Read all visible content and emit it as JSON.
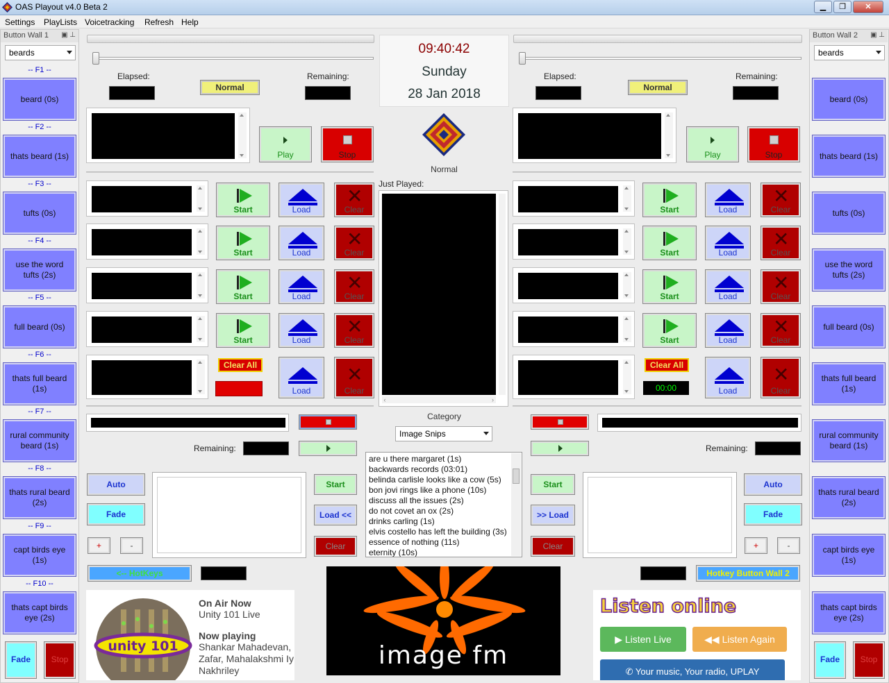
{
  "window": {
    "title": "OAS Playout v4.0 Beta 2"
  },
  "menu": [
    "Settings",
    "PlayLists",
    "Voicetracking",
    "Refresh",
    "Help"
  ],
  "left_wall": {
    "title": "Button Wall 1",
    "combo": "beards",
    "slots": [
      {
        "key": "-- F1 --",
        "label": "beard (0s)"
      },
      {
        "key": "-- F2 --",
        "label": "thats beard (1s)"
      },
      {
        "key": "-- F3 --",
        "label": "tufts (0s)"
      },
      {
        "key": "-- F4 --",
        "label": "use the word tufts (2s)"
      },
      {
        "key": "-- F5 --",
        "label": "full beard (0s)"
      },
      {
        "key": "-- F6 --",
        "label": "thats full beard (1s)"
      },
      {
        "key": "-- F7 --",
        "label": "rural community beard (1s)"
      },
      {
        "key": "-- F8 --",
        "label": "thats rural beard (2s)"
      },
      {
        "key": "-- F9 --",
        "label": "capt birds eye (1s)"
      },
      {
        "key": "-- F10 --",
        "label": "thats capt birds eye (2s)"
      }
    ],
    "fade": "Fade",
    "stop": "Stop"
  },
  "right_wall": {
    "title": "Button Wall 2",
    "combo": "beards",
    "slots": [
      {
        "label": "beard (0s)"
      },
      {
        "label": "thats beard (1s)"
      },
      {
        "label": "tufts (0s)"
      },
      {
        "label": "use the word tufts (2s)"
      },
      {
        "label": "full beard (0s)"
      },
      {
        "label": "thats full beard (1s)"
      },
      {
        "label": "rural community beard (1s)"
      },
      {
        "label": "thats rural beard (2s)"
      },
      {
        "label": "capt birds eye (1s)"
      },
      {
        "label": "thats capt birds eye (2s)"
      }
    ],
    "fade": "Fade",
    "stop": "Stop"
  },
  "clock": {
    "time": "09:40:42",
    "day": "Sunday",
    "date": "28 Jan 2018",
    "mode": "Normal"
  },
  "player_left": {
    "elapsed": "Elapsed:",
    "remaining": "Remaining:",
    "mode": "Normal",
    "play": "Play",
    "stop": "Stop"
  },
  "player_right": {
    "elapsed": "Elapsed:",
    "remaining": "Remaining:",
    "mode": "Normal",
    "play": "Play",
    "stop": "Stop"
  },
  "cart": {
    "start": "Start",
    "load": "Load",
    "clear": "Clear",
    "clear_all": "Clear All",
    "counter_right": "00:00"
  },
  "just_played": "Just Played:",
  "category": {
    "label": "Category",
    "selected": "Image Snips",
    "items": [
      "are u there margaret (1s)",
      "backwards records (03:01)",
      "belinda carlisle looks like a cow (5s)",
      "bon jovi rings like a phone (10s)",
      "discuss all the issues (2s)",
      "do not covet an ox (2s)",
      "drinks carling (1s)",
      "elvis costello has left the building (3s)",
      "essence of nothing (11s)",
      "eternity (10s)"
    ]
  },
  "bottom_left": {
    "remaining": "Remaining:",
    "auto": "Auto",
    "fade": "Fade",
    "plus": "+",
    "minus": "-",
    "start": "Start",
    "load": "Load <<",
    "clear": "Clear",
    "hotkeys": "<-- HotKeys"
  },
  "bottom_right": {
    "remaining": "Remaining:",
    "auto": "Auto",
    "fade": "Fade",
    "plus": "+",
    "minus": "-",
    "start": "Start",
    "load": ">> Load",
    "clear": "Clear",
    "hotkeys": "Hotkey Button Wall 2"
  },
  "on_air": {
    "heading": "On Air Now",
    "station": "Unity 101 Live",
    "now_heading": "Now playing",
    "now_lines": [
      "Shankar Mahadevan,",
      "Zafar, Mahalakshmi Iy",
      "Nakhriley"
    ],
    "logo_text": "unity 101"
  },
  "image_fm": {
    "text": "image fm"
  },
  "listen_online": {
    "title": "Listen online",
    "live": "Listen Live",
    "again": "Listen Again",
    "uplay": "Your music, Your radio, UPLAY"
  },
  "colors": {
    "wall_button": "#8080ff",
    "play_green": "#c8f5c8",
    "stop_red": "#d80000",
    "load_blue": "#cdd5f8",
    "fade_cyan": "#80ffff",
    "normal_yellow": "#f0f07a"
  }
}
